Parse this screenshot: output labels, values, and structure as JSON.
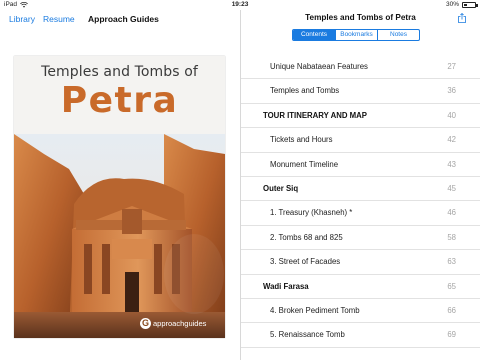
{
  "status_bar": {
    "device": "iPad",
    "time": "19:23",
    "battery": "30%"
  },
  "left_nav": {
    "library": "Library",
    "resume": "Resume",
    "title": "Approach Guides"
  },
  "cover": {
    "subtitle": "Temples and Tombs of",
    "main_title": "Petra",
    "brand": "approachguides",
    "colors": {
      "title": "#c96a2a",
      "sky": "#e9eef3",
      "stone": "#c9783f"
    }
  },
  "right_pane": {
    "title": "Temples and Tombs of Petra",
    "tabs": [
      {
        "label": "Contents",
        "active": true
      },
      {
        "label": "Bookmarks",
        "active": false
      },
      {
        "label": "Notes",
        "active": false
      }
    ],
    "toc": [
      {
        "label": "Unique Nabataean Features",
        "page": "27",
        "section": false
      },
      {
        "label": "Temples and Tombs",
        "page": "36",
        "section": false
      },
      {
        "label": "TOUR ITINERARY AND MAP",
        "page": "40",
        "section": true
      },
      {
        "label": "Tickets and Hours",
        "page": "42",
        "section": false
      },
      {
        "label": "Monument Timeline",
        "page": "43",
        "section": false
      },
      {
        "label": "Outer Siq",
        "page": "45",
        "section": true
      },
      {
        "label": "1. Treasury (Khasneh) *",
        "page": "46",
        "section": false
      },
      {
        "label": "2. Tombs 68 and 825",
        "page": "58",
        "section": false
      },
      {
        "label": "3. Street of Facades",
        "page": "63",
        "section": false
      },
      {
        "label": "Wadi Farasa",
        "page": "65",
        "section": true
      },
      {
        "label": "4. Broken Pediment Tomb",
        "page": "66",
        "section": false
      },
      {
        "label": "5. Renaissance Tomb",
        "page": "69",
        "section": false
      }
    ]
  },
  "accent_color": "#1a7be0"
}
